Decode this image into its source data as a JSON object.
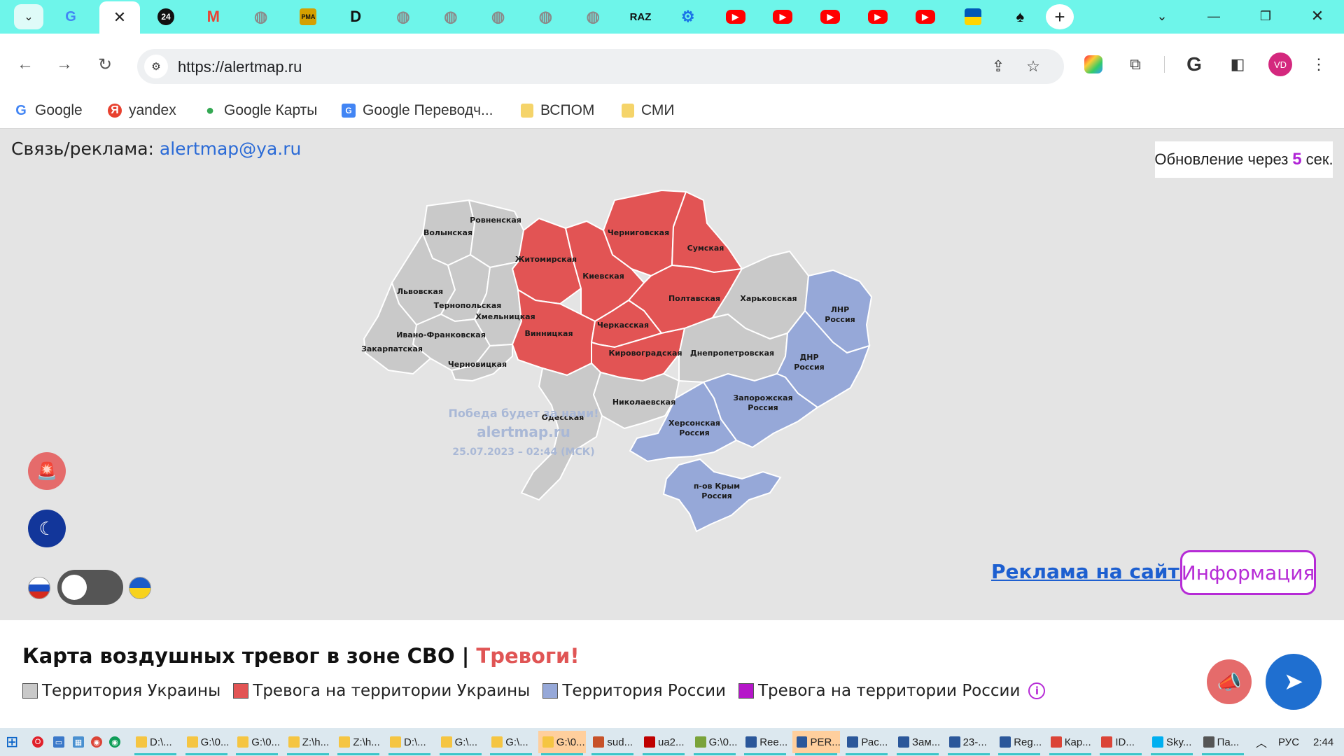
{
  "browser": {
    "tabs": [
      {
        "icon": "google-icon",
        "glyph": "G",
        "color": "#4285f4"
      },
      {
        "icon": "24-icon",
        "glyph": "24",
        "color": "#111111"
      },
      {
        "icon": "gmail-icon",
        "glyph": "M",
        "color": "#ea4335"
      },
      {
        "icon": "globe-icon",
        "glyph": "◍",
        "color": "#8a8a8a"
      },
      {
        "icon": "rma-icon",
        "glyph": "РМА",
        "color": "#d4a000"
      },
      {
        "icon": "d-icon",
        "glyph": "D",
        "color": "#111111"
      },
      {
        "icon": "globe-icon",
        "glyph": "◍",
        "color": "#8a8a8a"
      },
      {
        "icon": "globe-icon",
        "glyph": "◍",
        "color": "#8a8a8a"
      },
      {
        "icon": "globe-icon",
        "glyph": "◍",
        "color": "#8a8a8a"
      },
      {
        "icon": "globe-icon",
        "glyph": "◍",
        "color": "#8a8a8a"
      },
      {
        "icon": "globe-icon",
        "glyph": "◍",
        "color": "#8a8a8a"
      },
      {
        "icon": "raz-icon",
        "glyph": "RAZ",
        "color": "#111111"
      },
      {
        "icon": "gear-icon",
        "glyph": "⚙",
        "color": "#1a73e8"
      },
      {
        "icon": "youtube-icon",
        "glyph": "▶",
        "color": "#ff0000"
      },
      {
        "icon": "youtube-icon",
        "glyph": "▶",
        "color": "#ff0000"
      },
      {
        "icon": "youtube-icon",
        "glyph": "▶",
        "color": "#ff0000"
      },
      {
        "icon": "youtube-icon",
        "glyph": "▶",
        "color": "#ff0000"
      },
      {
        "icon": "youtube-icon",
        "glyph": "▶",
        "color": "#ff0000"
      },
      {
        "icon": "ukraine-flag-icon",
        "glyph": "",
        "color": "#0057b7"
      },
      {
        "icon": "spade-icon",
        "glyph": "♠",
        "color": "#111111"
      }
    ],
    "url": "https://alertmap.ru",
    "avatar": "VD",
    "bookmarks": [
      {
        "label": "Google",
        "icon": "google-icon",
        "glyph": "G",
        "color": "#4285f4"
      },
      {
        "label": "yandex",
        "icon": "yandex-icon",
        "glyph": "Я",
        "color": "#e8412f"
      },
      {
        "label": "Google Карты",
        "icon": "maps-pin-icon",
        "glyph": "●",
        "color": "#34a853"
      },
      {
        "label": "Google Переводч...",
        "icon": "translate-icon",
        "glyph": "G",
        "color": "#4285f4"
      },
      {
        "label": "ВСПОМ",
        "icon": "folder-icon",
        "glyph": "",
        "color": "#f5d46a"
      },
      {
        "label": "СМИ",
        "icon": "folder-icon",
        "glyph": "",
        "color": "#f5d46a"
      }
    ]
  },
  "page": {
    "contact_label": "Связь/реклама:",
    "contact_email": "alertmap@ya.ru",
    "update_prefix": "Обновление через",
    "update_seconds": "5",
    "update_suffix": "сек.",
    "watermark_line1": "Победа будет за нами!",
    "watermark_line2": "alertmap.ru",
    "watermark_line3": "25.07.2023 – 02:44 (МСК)",
    "ad_link": "Реклама на сайте",
    "info_button": "Информация",
    "title_main": "Карта воздушных тревог в зоне СВО | ",
    "title_alarm": "Тревоги!",
    "legend": [
      {
        "label": "Территория Украины",
        "color": "#c9c9c9"
      },
      {
        "label": "Тревога на территории Украины",
        "color": "#e25454"
      },
      {
        "label": "Территория России",
        "color": "#96a8d8"
      },
      {
        "label": "Тревога на территории России",
        "color": "#b516c9"
      }
    ],
    "colors": {
      "ukraine": "#c9c9c9",
      "alert": "#e25454",
      "russia": "#96a8d8",
      "accent": "#b62bd6"
    },
    "regions": [
      {
        "id": "volyn",
        "name": "Волынская",
        "status": "ukraine"
      },
      {
        "id": "rivne",
        "name": "Ровненская",
        "status": "ukraine"
      },
      {
        "id": "zhytomyr",
        "name": "Житомирская",
        "status": "alert"
      },
      {
        "id": "chernihiv",
        "name": "Черниговская",
        "status": "alert"
      },
      {
        "id": "sumy",
        "name": "Сумская",
        "status": "alert"
      },
      {
        "id": "lviv",
        "name": "Львовская",
        "status": "ukraine"
      },
      {
        "id": "ternopil",
        "name": "Тернопольская",
        "status": "ukraine"
      },
      {
        "id": "khmelnytskyi",
        "name": "Хмельницкая",
        "status": "ukraine"
      },
      {
        "id": "kyiv",
        "name": "Киевская",
        "status": "alert"
      },
      {
        "id": "poltava",
        "name": "Полтавская",
        "status": "alert"
      },
      {
        "id": "kharkiv",
        "name": "Харьковская",
        "status": "ukraine"
      },
      {
        "id": "lnr",
        "name": "ЛНР|Россия",
        "status": "russia"
      },
      {
        "id": "ivano",
        "name": "Ивано-Франковская",
        "status": "ukraine"
      },
      {
        "id": "zakarpattia",
        "name": "Закарпатская",
        "status": "ukraine"
      },
      {
        "id": "chernivtsi",
        "name": "Черновицкая",
        "status": "ukraine"
      },
      {
        "id": "vinnytsia",
        "name": "Винницкая",
        "status": "alert"
      },
      {
        "id": "cherkasy",
        "name": "Черкасская",
        "status": "alert"
      },
      {
        "id": "kirovohrad",
        "name": "Кировоградская",
        "status": "alert"
      },
      {
        "id": "dnipro",
        "name": "Днепропетровская",
        "status": "ukraine"
      },
      {
        "id": "dnr",
        "name": "ДНР|Россия",
        "status": "russia"
      },
      {
        "id": "odesa",
        "name": "Одесская",
        "status": "ukraine"
      },
      {
        "id": "mykolaiv",
        "name": "Николаевская",
        "status": "ukraine"
      },
      {
        "id": "zaporizhzhia",
        "name": "Запорожская|Россия",
        "status": "russia"
      },
      {
        "id": "kherson",
        "name": "Херсонская|Россия",
        "status": "russia"
      },
      {
        "id": "crimea",
        "name": "п-ов Крым|Россия",
        "status": "russia"
      }
    ]
  },
  "taskbar": {
    "items": [
      {
        "label": "D:\\...",
        "icon": "folder-icon",
        "color": "#f5c542"
      },
      {
        "label": "G:\\0...",
        "icon": "folder-icon",
        "color": "#f5c542"
      },
      {
        "label": "G:\\0...",
        "icon": "folder-icon",
        "color": "#f5c542"
      },
      {
        "label": "Z:\\h...",
        "icon": "folder-icon",
        "color": "#f5c542"
      },
      {
        "label": "Z:\\h...",
        "icon": "folder-icon",
        "color": "#f5c542"
      },
      {
        "label": "D:\\...",
        "icon": "folder-icon",
        "color": "#f5c542"
      },
      {
        "label": "G:\\...",
        "icon": "folder-icon",
        "color": "#f5c542"
      },
      {
        "label": "G:\\...",
        "icon": "folder-icon",
        "color": "#f5c542"
      },
      {
        "label": "G:\\0...",
        "icon": "folder-icon",
        "color": "#f5c542",
        "active": true
      },
      {
        "label": "sud...",
        "icon": "search-icon",
        "color": "#c7522a"
      },
      {
        "label": "ua2...",
        "icon": "filezilla-icon",
        "color": "#bf0000"
      },
      {
        "label": "G:\\0...",
        "icon": "notepad-icon",
        "color": "#7aa33a"
      },
      {
        "label": "Ree...",
        "icon": "word-icon",
        "color": "#2b579a"
      },
      {
        "label": "PER...",
        "icon": "word-icon",
        "color": "#2b579a",
        "active": true
      },
      {
        "label": "Рас...",
        "icon": "word-icon",
        "color": "#2b579a"
      },
      {
        "label": "Зам...",
        "icon": "word-icon",
        "color": "#2b579a"
      },
      {
        "label": "23-...",
        "icon": "word-icon",
        "color": "#2b579a"
      },
      {
        "label": "Reg...",
        "icon": "word-icon",
        "color": "#2b579a"
      },
      {
        "label": "Кар...",
        "icon": "chrome-icon",
        "color": "#db4437"
      },
      {
        "label": "ID...",
        "icon": "chrome-icon",
        "color": "#db4437"
      },
      {
        "label": "Sky...",
        "icon": "skype-icon",
        "color": "#00aff0"
      },
      {
        "label": "Па...",
        "icon": "gear-icon",
        "color": "#555555"
      }
    ],
    "lang": "РУС",
    "time": "2:44"
  }
}
